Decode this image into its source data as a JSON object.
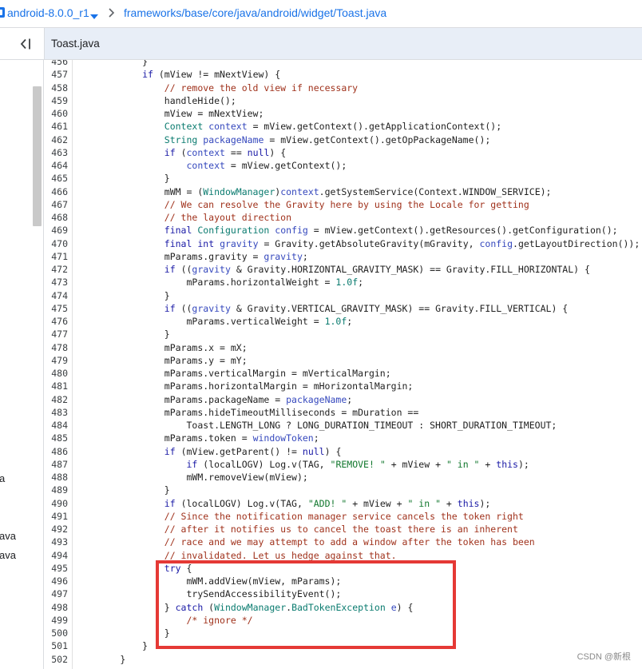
{
  "header": {
    "branch": "android-8.0.0_r1",
    "path": "frameworks/base/core/java/android/widget/Toast.java"
  },
  "tabbar": {
    "active_tab": "Toast.java"
  },
  "sidebar": {
    "labels": [
      "a",
      "ava",
      "ava"
    ]
  },
  "watermark": "CSDN @新根",
  "colors": {
    "accent": "#1a73e8",
    "highlight": "#e53935",
    "keyword": "#1a1aa6",
    "type": "#0a7b6f",
    "variable": "#3548bd",
    "string": "#11772d",
    "comment": "#a0321c",
    "number": "#0a7b6f"
  },
  "code": {
    "lines": [
      {
        "n": "456",
        "t": [
          "            }"
        ]
      },
      {
        "n": "457",
        "t": [
          "            ",
          [
            "#1a1aa6",
            "if"
          ],
          " (mView != mNextView) {"
        ]
      },
      {
        "n": "458",
        "t": [
          "                ",
          [
            "#a0321c",
            "// remove the old view if necessary"
          ]
        ]
      },
      {
        "n": "459",
        "t": [
          "                handleHide();"
        ]
      },
      {
        "n": "460",
        "t": [
          "                mView = mNextView;"
        ]
      },
      {
        "n": "461",
        "t": [
          "                ",
          [
            "#0a7b6f",
            "Context"
          ],
          " ",
          [
            "#3548bd",
            "context"
          ],
          " = mView.getContext().getApplicationContext();"
        ]
      },
      {
        "n": "462",
        "t": [
          "                ",
          [
            "#0a7b6f",
            "String"
          ],
          " ",
          [
            "#3548bd",
            "packageName"
          ],
          " = mView.getContext().getOpPackageName();"
        ]
      },
      {
        "n": "463",
        "t": [
          "                ",
          [
            "#1a1aa6",
            "if"
          ],
          " (",
          [
            "#3548bd",
            "context"
          ],
          " == ",
          [
            "#1a1aa6",
            "null"
          ],
          ") {"
        ]
      },
      {
        "n": "464",
        "t": [
          "                    ",
          [
            "#3548bd",
            "context"
          ],
          " = mView.getContext();"
        ]
      },
      {
        "n": "465",
        "t": [
          "                }"
        ]
      },
      {
        "n": "466",
        "t": [
          "                mWM = (",
          [
            "#0a7b6f",
            "WindowManager"
          ],
          ")",
          [
            "#3548bd",
            "context"
          ],
          ".getSystemService(Context.WINDOW_SERVICE);"
        ]
      },
      {
        "n": "467",
        "t": [
          "                ",
          [
            "#a0321c",
            "// We can resolve the Gravity here by using the Locale for getting"
          ]
        ]
      },
      {
        "n": "468",
        "t": [
          "                ",
          [
            "#a0321c",
            "// the layout direction"
          ]
        ]
      },
      {
        "n": "469",
        "t": [
          "                ",
          [
            "#1a1aa6",
            "final"
          ],
          " ",
          [
            "#0a7b6f",
            "Configuration"
          ],
          " ",
          [
            "#3548bd",
            "config"
          ],
          " = mView.getContext().getResources().getConfiguration();"
        ]
      },
      {
        "n": "470",
        "t": [
          "                ",
          [
            "#1a1aa6",
            "final"
          ],
          " ",
          [
            "#1a1aa6",
            "int"
          ],
          " ",
          [
            "#3548bd",
            "gravity"
          ],
          " = Gravity.getAbsoluteGravity(mGravity, ",
          [
            "#3548bd",
            "config"
          ],
          ".getLayoutDirection());"
        ]
      },
      {
        "n": "471",
        "t": [
          "                mParams.gravity = ",
          [
            "#3548bd",
            "gravity"
          ],
          ";"
        ]
      },
      {
        "n": "472",
        "t": [
          "                ",
          [
            "#1a1aa6",
            "if"
          ],
          " ((",
          [
            "#3548bd",
            "gravity"
          ],
          " & Gravity.HORIZONTAL_GRAVITY_MASK) == Gravity.FILL_HORIZONTAL) {"
        ]
      },
      {
        "n": "473",
        "t": [
          "                    mParams.horizontalWeight = ",
          [
            "#0a7b6f",
            "1.0f"
          ],
          ";"
        ]
      },
      {
        "n": "474",
        "t": [
          "                }"
        ]
      },
      {
        "n": "475",
        "t": [
          "                ",
          [
            "#1a1aa6",
            "if"
          ],
          " ((",
          [
            "#3548bd",
            "gravity"
          ],
          " & Gravity.VERTICAL_GRAVITY_MASK) == Gravity.FILL_VERTICAL) {"
        ]
      },
      {
        "n": "476",
        "t": [
          "                    mParams.verticalWeight = ",
          [
            "#0a7b6f",
            "1.0f"
          ],
          ";"
        ]
      },
      {
        "n": "477",
        "t": [
          "                }"
        ]
      },
      {
        "n": "478",
        "t": [
          "                mParams.x = mX;"
        ]
      },
      {
        "n": "479",
        "t": [
          "                mParams.y = mY;"
        ]
      },
      {
        "n": "480",
        "t": [
          "                mParams.verticalMargin = mVerticalMargin;"
        ]
      },
      {
        "n": "481",
        "t": [
          "                mParams.horizontalMargin = mHorizontalMargin;"
        ]
      },
      {
        "n": "482",
        "t": [
          "                mParams.packageName = ",
          [
            "#3548bd",
            "packageName"
          ],
          ";"
        ]
      },
      {
        "n": "483",
        "t": [
          "                mParams.hideTimeoutMilliseconds = mDuration =="
        ]
      },
      {
        "n": "484",
        "t": [
          "                    Toast.LENGTH_LONG ? LONG_DURATION_TIMEOUT : SHORT_DURATION_TIMEOUT;"
        ]
      },
      {
        "n": "485",
        "t": [
          "                mParams.token = ",
          [
            "#3548bd",
            "windowToken"
          ],
          ";"
        ]
      },
      {
        "n": "486",
        "t": [
          "                ",
          [
            "#1a1aa6",
            "if"
          ],
          " (mView.getParent() != ",
          [
            "#1a1aa6",
            "null"
          ],
          ") {"
        ]
      },
      {
        "n": "487",
        "t": [
          "                    ",
          [
            "#1a1aa6",
            "if"
          ],
          " (localLOGV) Log.v(TAG, ",
          [
            "#11772d",
            "\"REMOVE! \""
          ],
          " + mView + ",
          [
            "#11772d",
            "\" in \""
          ],
          " + ",
          [
            "#1a1aa6",
            "this"
          ],
          ");"
        ]
      },
      {
        "n": "488",
        "t": [
          "                    mWM.removeView(mView);"
        ]
      },
      {
        "n": "489",
        "t": [
          "                }"
        ]
      },
      {
        "n": "490",
        "t": [
          "                ",
          [
            "#1a1aa6",
            "if"
          ],
          " (localLOGV) Log.v(TAG, ",
          [
            "#11772d",
            "\"ADD! \""
          ],
          " + mView + ",
          [
            "#11772d",
            "\" in \""
          ],
          " + ",
          [
            "#1a1aa6",
            "this"
          ],
          ");"
        ]
      },
      {
        "n": "491",
        "t": [
          "                ",
          [
            "#a0321c",
            "// Since the notification manager service cancels the token right"
          ]
        ]
      },
      {
        "n": "492",
        "t": [
          "                ",
          [
            "#a0321c",
            "// after it notifies us to cancel the toast there is an inherent"
          ]
        ]
      },
      {
        "n": "493",
        "t": [
          "                ",
          [
            "#a0321c",
            "// race and we may attempt to add a window after the token has been"
          ]
        ]
      },
      {
        "n": "494",
        "t": [
          "                ",
          [
            "#a0321c",
            "// invalidated. Let us hedge against that."
          ]
        ]
      },
      {
        "n": "495",
        "t": [
          "                ",
          [
            "#1a1aa6",
            "try"
          ],
          " {"
        ]
      },
      {
        "n": "496",
        "t": [
          "                    mWM.addView(mView, mParams);"
        ]
      },
      {
        "n": "497",
        "t": [
          "                    trySendAccessibilityEvent();"
        ]
      },
      {
        "n": "498",
        "t": [
          "                } ",
          [
            "#1a1aa6",
            "catch"
          ],
          " (",
          [
            "#0a7b6f",
            "WindowManager"
          ],
          ".",
          [
            "#0a7b6f",
            "BadTokenException"
          ],
          " ",
          [
            "#3548bd",
            "e"
          ],
          ") {"
        ]
      },
      {
        "n": "499",
        "t": [
          "                    ",
          [
            "#a0321c",
            "/* ignore */"
          ]
        ]
      },
      {
        "n": "500",
        "t": [
          "                }"
        ]
      },
      {
        "n": "501",
        "t": [
          "            }"
        ]
      },
      {
        "n": "502",
        "t": [
          "        }"
        ]
      }
    ]
  }
}
